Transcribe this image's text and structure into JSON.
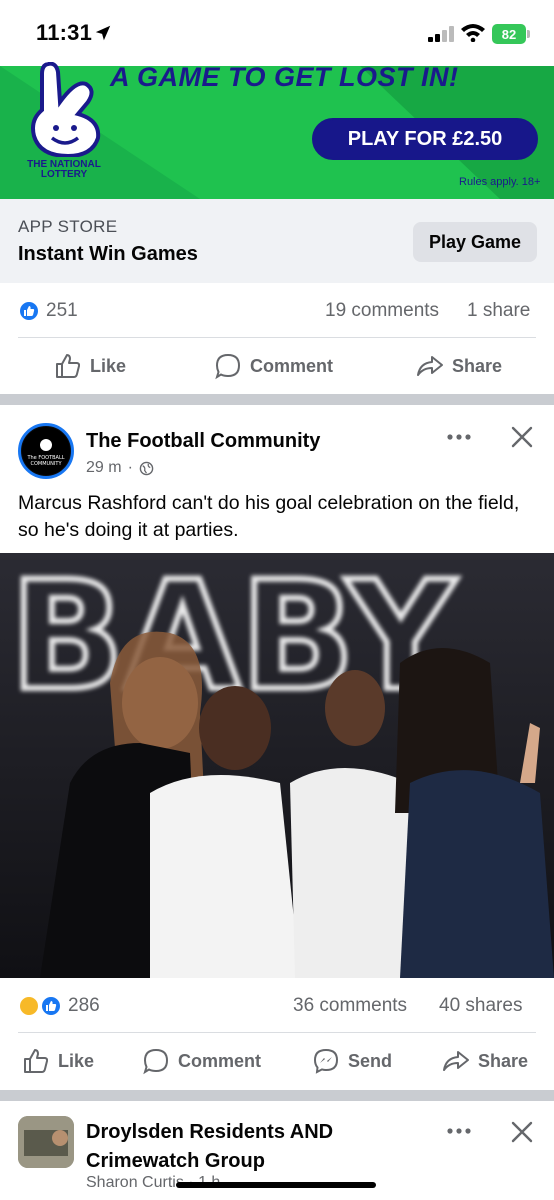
{
  "status_bar": {
    "time": "11:31",
    "battery": "82"
  },
  "ad": {
    "headline": "A GAME TO GET LOST IN!",
    "brand": "THE NATIONAL LOTTERY",
    "cta": "PLAY FOR £2.50",
    "rules": "Rules apply. 18+",
    "source": "APP STORE",
    "title": "Instant Win Games",
    "button": "Play Game",
    "reactions": "251",
    "comments": "19 comments",
    "shares": "1 share",
    "actions": {
      "like": "Like",
      "comment": "Comment",
      "share": "Share"
    }
  },
  "post": {
    "page_name": "The Football Community",
    "avatar_text": "The FOOTBALL COMMUNITY",
    "time": "29 m",
    "text": "Marcus Rashford can't do his goal celebration on the field, so he's doing it at parties.",
    "photo_sign": "BABY",
    "reactions": "286",
    "comments": "36 comments",
    "shares": "40 shares",
    "actions": {
      "like": "Like",
      "comment": "Comment",
      "send": "Send",
      "share": "Share"
    }
  },
  "next_post": {
    "group_name": "Droylsden Residents AND Crimewatch Group",
    "author": "Sharon Curtis",
    "time": "1 h"
  },
  "colors": {
    "brand_blue": "#1877f2",
    "lottery_green": "#19b24b",
    "lottery_navy": "#17178a"
  }
}
